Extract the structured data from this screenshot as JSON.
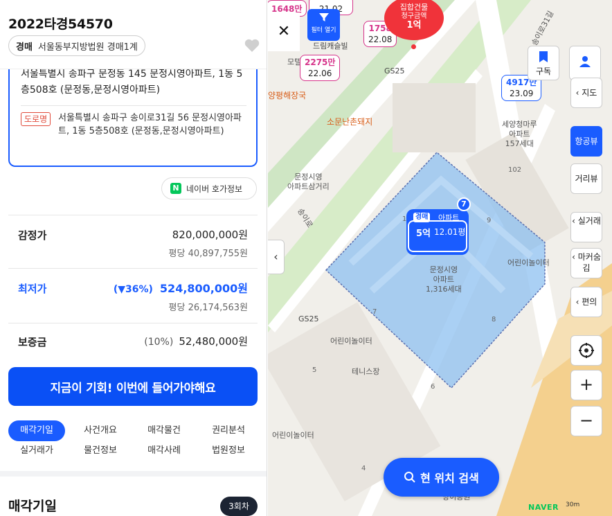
{
  "case": {
    "number": "2022타경54570",
    "kind": "경매",
    "court": "서울동부지방법원 경매1계"
  },
  "address": {
    "jibun": "서울특별시 송파구 문정동 145 문정시영아파트, 1동 5층508호 (문정동,문정시영아파트)",
    "road_tag": "도로명",
    "road": "서울특별시 송파구 송이로31길 56 문정시영아파트, 1동 5층508호 (문정동,문정시영아파트)"
  },
  "naver_info": {
    "logo": "N",
    "label": "네이버 호가정보"
  },
  "prices": {
    "appraisal": {
      "label": "감정가",
      "value": "820,000,000원",
      "per_pyeong": "평당 40,897,755원"
    },
    "minimum": {
      "label": "최저가",
      "pct": "(▼36%)",
      "value": "524,800,000원",
      "per_pyeong": "평당 26,174,563원"
    },
    "deposit": {
      "label": "보증금",
      "pct": "(10%)",
      "value": "52,480,000원"
    }
  },
  "cta": "지금이 기회! 이번에 들어가야해요",
  "tabs": [
    "매각기일",
    "사건개요",
    "매각물건",
    "권리분석",
    "실거래가",
    "물건정보",
    "매각사례",
    "법원정보"
  ],
  "section": {
    "title": "매각기일",
    "badge": "3회차"
  },
  "map": {
    "close": "✕",
    "filter_label": "필터 열기",
    "collapse": "‹",
    "red_marker": {
      "line1": "집합건물",
      "line2": "청구금액",
      "amount": "1억"
    },
    "price_pins": [
      {
        "price": "1648만",
        "date": ""
      },
      {
        "price": "",
        "date": "21.02"
      },
      {
        "price": "1758",
        "date": "22.08"
      },
      {
        "price": "2275만",
        "date": "22.06"
      },
      {
        "price": "4917만",
        "date": "23.09"
      }
    ],
    "complex": {
      "tag": "경매",
      "type": "아파트",
      "price": "5억",
      "date": "12.01평",
      "count": "7"
    },
    "labels": {
      "villa": "드림캐슬빌",
      "motel": "모텔",
      "gs25_top": "GS25",
      "restaurant1": "양평해장국",
      "restaurant2": "소문난촌돼지",
      "apt_name": "세양청마루",
      "apt_suffix": "아파트",
      "apt_units": "157세대",
      "crossroad1": "문정시영",
      "crossroad2": "아파트삼거리",
      "complex_name": "문정시영",
      "complex_suffix": "아파트",
      "complex_units": "1,316세대",
      "playground_right": "어린이놀이터",
      "gs25_mid": "GS25",
      "playground_mid": "어린이놀이터",
      "tennis": "테니스장",
      "playground_bottom": "어린이놀이터",
      "park": "방이공원",
      "road_top": "송이로31길",
      "road_left": "송이로"
    },
    "building_numbers": [
      "102",
      "10",
      "9",
      "8",
      "7",
      "6",
      "5",
      "4"
    ],
    "side_buttons": {
      "subscribe": "구독",
      "map": "지도",
      "aerial": "항공뷰",
      "street": "거리뷰",
      "real_trade": "실거래",
      "hide_markers": "마커숨김",
      "amenities": "편의",
      "zoom_in": "+",
      "zoom_out": "−"
    },
    "search_here": "현 위치 검색",
    "naver_logo": "NAVER",
    "scale": "30m"
  },
  "colors": {
    "accent": "#1a5cff",
    "cta": "#0a50f5",
    "price_pin": "#d6338a",
    "red_marker": "#f0333a",
    "polygon_fill": "#8ec0f0",
    "naver_green": "#03c75a"
  }
}
